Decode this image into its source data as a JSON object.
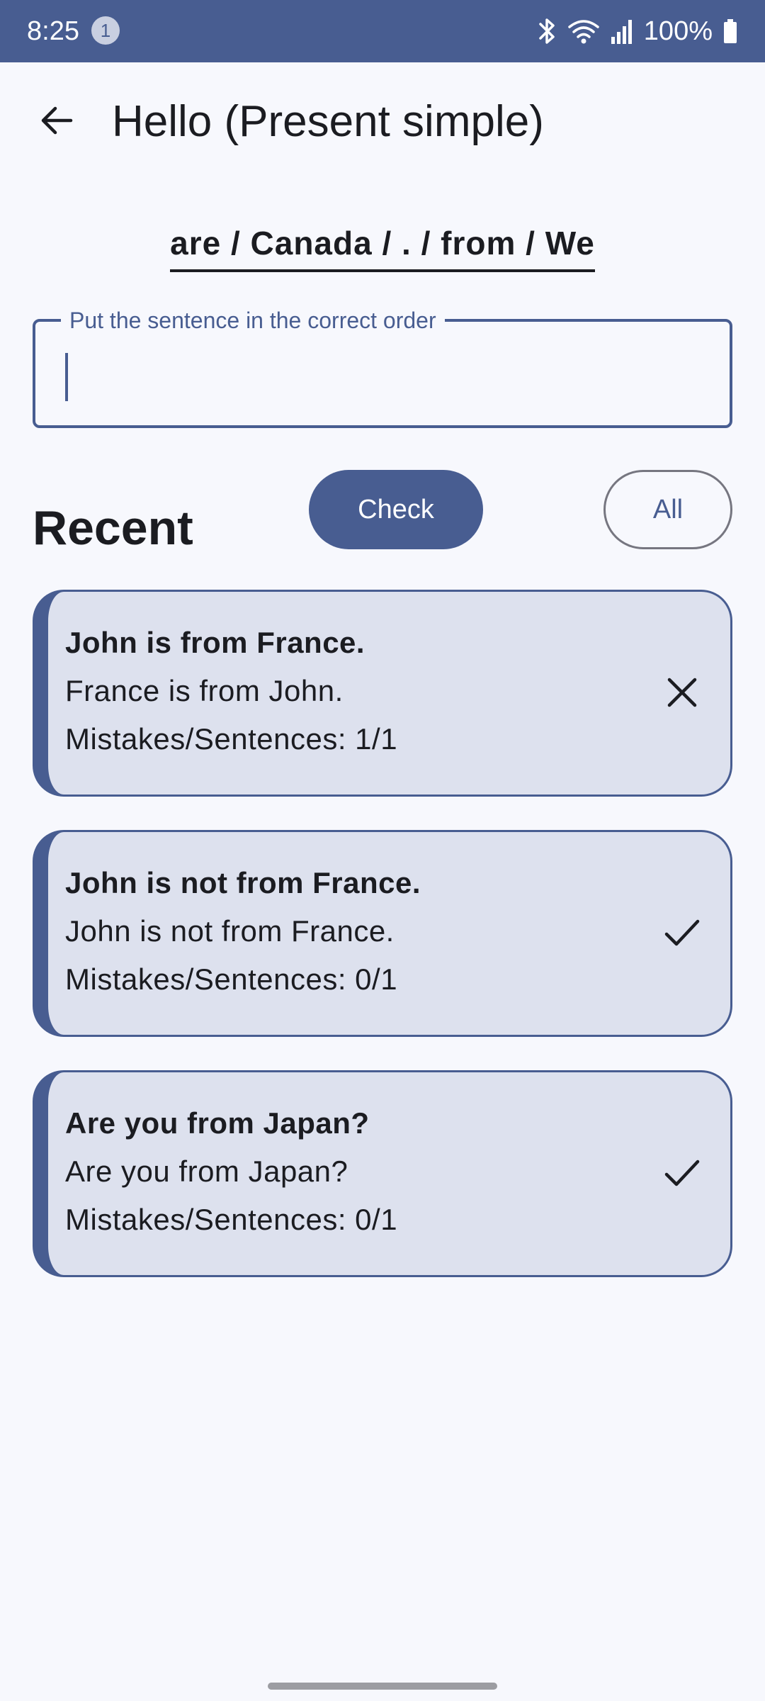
{
  "status_bar": {
    "time": "8:25",
    "notification_count": "1",
    "battery": "100%",
    "icons": [
      "bluetooth-icon",
      "wifi-icon",
      "signal-icon",
      "battery-icon"
    ]
  },
  "app_bar": {
    "back_icon": "arrow-back-icon",
    "title": "Hello (Present simple)"
  },
  "exercise": {
    "scrambled_words": "are / Canada / . / from / We",
    "input": {
      "label": "Put the sentence in the correct order",
      "value": ""
    }
  },
  "actions": {
    "check_label": "Check",
    "all_label": "All"
  },
  "recent": {
    "heading": "Recent",
    "items": [
      {
        "correct_sentence": "John is from France.",
        "user_answer": "France is from John.",
        "stats": "Mistakes/Sentences: 1/1",
        "status": "incorrect",
        "status_icon": "close-icon"
      },
      {
        "correct_sentence": "John is not from France.",
        "user_answer": "John is not from France.",
        "stats": "Mistakes/Sentences: 0/1",
        "status": "correct",
        "status_icon": "check-icon"
      },
      {
        "correct_sentence": "Are you from Japan?",
        "user_answer": "Are you from Japan?",
        "stats": "Mistakes/Sentences: 0/1",
        "status": "correct",
        "status_icon": "check-icon"
      }
    ]
  },
  "colors": {
    "primary": "#485d91",
    "card_background": "#dde1ee",
    "page_background": "#f7f8fd",
    "text": "#1b1c21"
  }
}
